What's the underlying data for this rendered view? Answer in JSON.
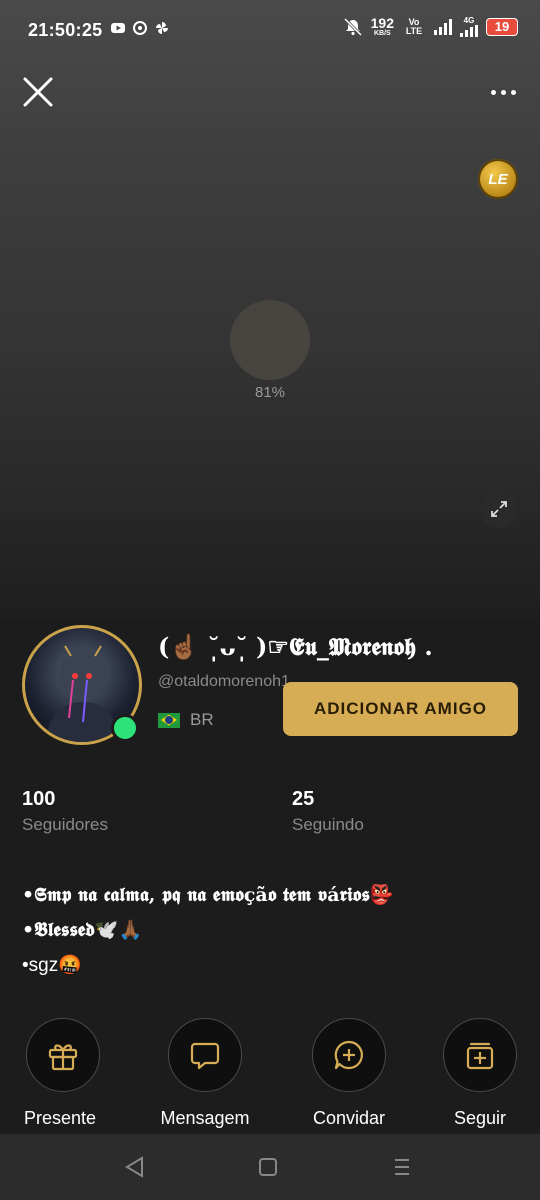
{
  "status_bar": {
    "time": "21:50:25",
    "speed_value": "192",
    "speed_unit": "KB/S",
    "volte": "Vo LTE",
    "network": "4G",
    "battery": "19"
  },
  "media": {
    "loading_percent": "81%",
    "progress_fraction": 0.81,
    "badge_text": "LE"
  },
  "profile": {
    "display_name": "(☝🏾 ˘̩̩̩ᴗ˘̩̩̩ )☞𝕰𝖚_𝕸𝖔𝖗𝖊𝖓𝖔𝖍 .",
    "username": "@otaldomorenoh1",
    "country": "BR",
    "online": true,
    "add_friend_label": "ADICIONAR AMIGO"
  },
  "stats": [
    {
      "value": "100",
      "label": "Seguidores"
    },
    {
      "value": "25",
      "label": "Seguindo"
    }
  ],
  "bio": [
    "•𝕾𝖒𝖕 𝖓𝖆 𝖈𝖆𝖑𝖒𝖆, 𝖕𝖖 𝖓𝖆 𝖊𝖒𝖔çã𝖔 𝖙𝖊𝖒 𝖛á𝖗𝖎𝖔𝖘👺",
    "•𝕭𝖑𝖊𝖘𝖘𝖊𝖉🕊️🙏🏾",
    "•sgz🤬"
  ],
  "actions": [
    {
      "label": "Presente",
      "icon": "gift-icon"
    },
    {
      "label": "Mensagem",
      "icon": "message-icon"
    },
    {
      "label": "Convidar",
      "icon": "invite-icon"
    },
    {
      "label": "Seguir",
      "icon": "follow-icon"
    }
  ],
  "colors": {
    "accent": "#d6ad55",
    "online": "#2ee27a",
    "battery": "#e74c3c"
  }
}
